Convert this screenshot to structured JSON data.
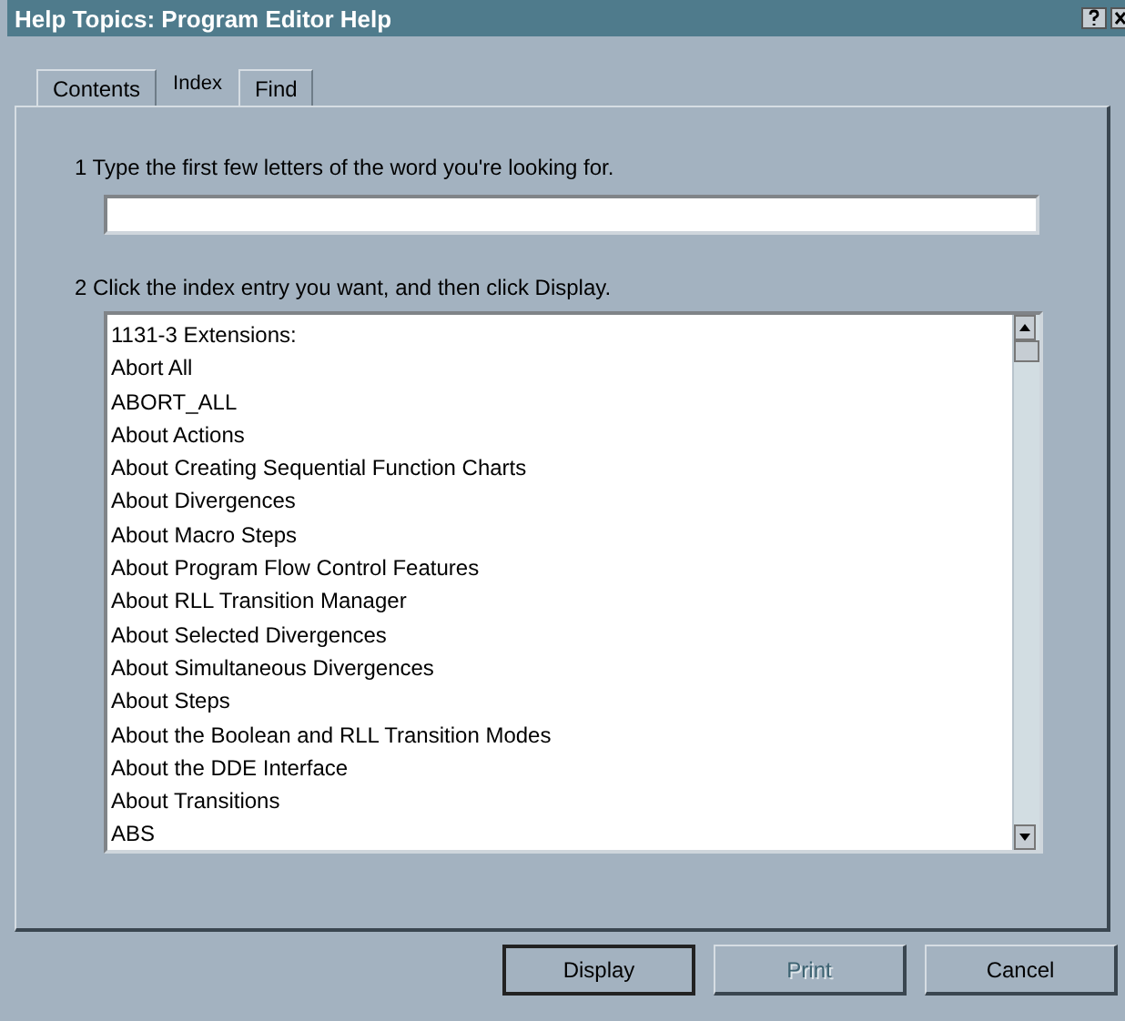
{
  "window": {
    "title": "Help Topics: Program Editor Help"
  },
  "tabs": [
    {
      "label": "Contents",
      "selected": false
    },
    {
      "label": "Index",
      "selected": true
    },
    {
      "label": "Find",
      "selected": false
    }
  ],
  "step_1": {
    "label": "1  Type the first few letters of the word you're looking for."
  },
  "step_2": {
    "label": "2  Click the index entry you want, and then click Display."
  },
  "index_list": {
    "items": [
      "1131-3 Extensions:",
      "Abort All",
      "ABORT_ALL",
      "About Actions",
      "About Creating Sequential Function Charts",
      "About Divergences",
      "About Macro Steps",
      "About Program Flow Control Features",
      "About RLL Transition Manager",
      "About Selected Divergences",
      "About Simultaneous Divergences",
      "About Steps",
      "About the Boolean and RLL Transition Modes",
      "About the DDE Interface",
      "About Transitions",
      "ABS"
    ]
  },
  "buttons": [
    {
      "label": "Display",
      "disabled": false,
      "default": true
    },
    {
      "label": "Print",
      "disabled": true,
      "default": false
    },
    {
      "label": "Cancel",
      "disabled": false,
      "default": false
    }
  ]
}
